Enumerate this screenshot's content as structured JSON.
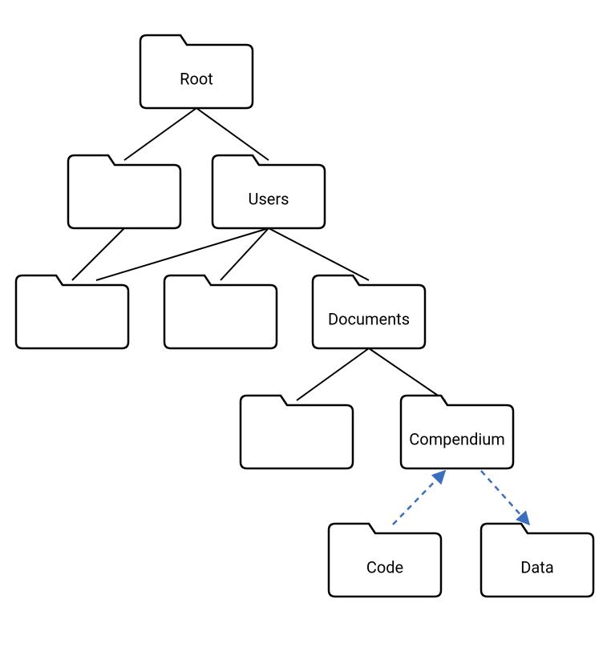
{
  "diagram": {
    "type": "tree",
    "nodes": {
      "root": {
        "label": "Root"
      },
      "l1_left": {
        "label": ""
      },
      "l1_users": {
        "label": "Users"
      },
      "l2_a": {
        "label": ""
      },
      "l2_b": {
        "label": ""
      },
      "l2_docs": {
        "label": "Documents"
      },
      "l3_a": {
        "label": ""
      },
      "l3_comp": {
        "label": "Compendium"
      },
      "l4_code": {
        "label": "Code"
      },
      "l4_data": {
        "label": "Data"
      }
    },
    "edges": [
      {
        "from": "root",
        "to": "l1_left",
        "style": "solid"
      },
      {
        "from": "root",
        "to": "l1_users",
        "style": "solid"
      },
      {
        "from": "l1_left",
        "to": "l2_a",
        "style": "solid"
      },
      {
        "from": "l1_users",
        "to": "l2_a",
        "style": "solid"
      },
      {
        "from": "l1_users",
        "to": "l2_b",
        "style": "solid"
      },
      {
        "from": "l1_users",
        "to": "l2_docs",
        "style": "solid"
      },
      {
        "from": "l2_docs",
        "to": "l3_a",
        "style": "solid"
      },
      {
        "from": "l2_docs",
        "to": "l3_comp",
        "style": "solid"
      },
      {
        "from": "l4_code",
        "to": "l3_comp",
        "style": "dashed-arrow"
      },
      {
        "from": "l3_comp",
        "to": "l4_data",
        "style": "dashed-arrow"
      }
    ],
    "colors": {
      "solid_edge": "#000000",
      "dashed_edge": "#3b6ebf",
      "node_fill": "#ffffff",
      "node_stroke": "#000000"
    }
  }
}
